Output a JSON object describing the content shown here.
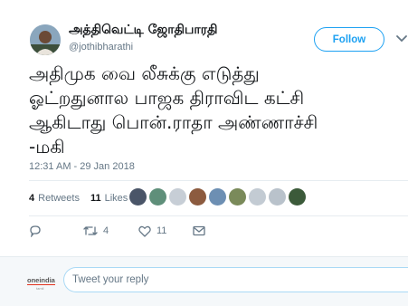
{
  "tweet": {
    "author_name": "அத்திவெட்டி ஜோதிபாரதி",
    "author_handle": "@jothibharathi",
    "follow_label": "Follow",
    "text_lines": [
      "அதிமுக வை லீசுக்கு எடுத்து",
      "ஓட்றதுனால பாஜக திராவிட கட்சி",
      "ஆகிடாது பொன்.ராதா அண்ணாச்சி",
      "-மகி"
    ],
    "timestamp": "12:31 AM - 29 Jan 2018",
    "retweets_count": "4",
    "retweets_label": "Retweets",
    "likes_count": "11",
    "likes_label": "Likes",
    "liker_count": 9,
    "actions": {
      "reply_icon": "reply-icon",
      "retweet_icon": "retweet-icon",
      "retweet_count": "4",
      "like_icon": "heart-icon",
      "like_count": "11",
      "message_icon": "envelope-icon"
    }
  },
  "reply": {
    "placeholder": "Tweet your reply",
    "logo_text": "oneindia"
  },
  "colors": {
    "accent": "#1da1f2",
    "muted": "#657786",
    "divider": "#e6ecf0",
    "text": "#14171a"
  }
}
